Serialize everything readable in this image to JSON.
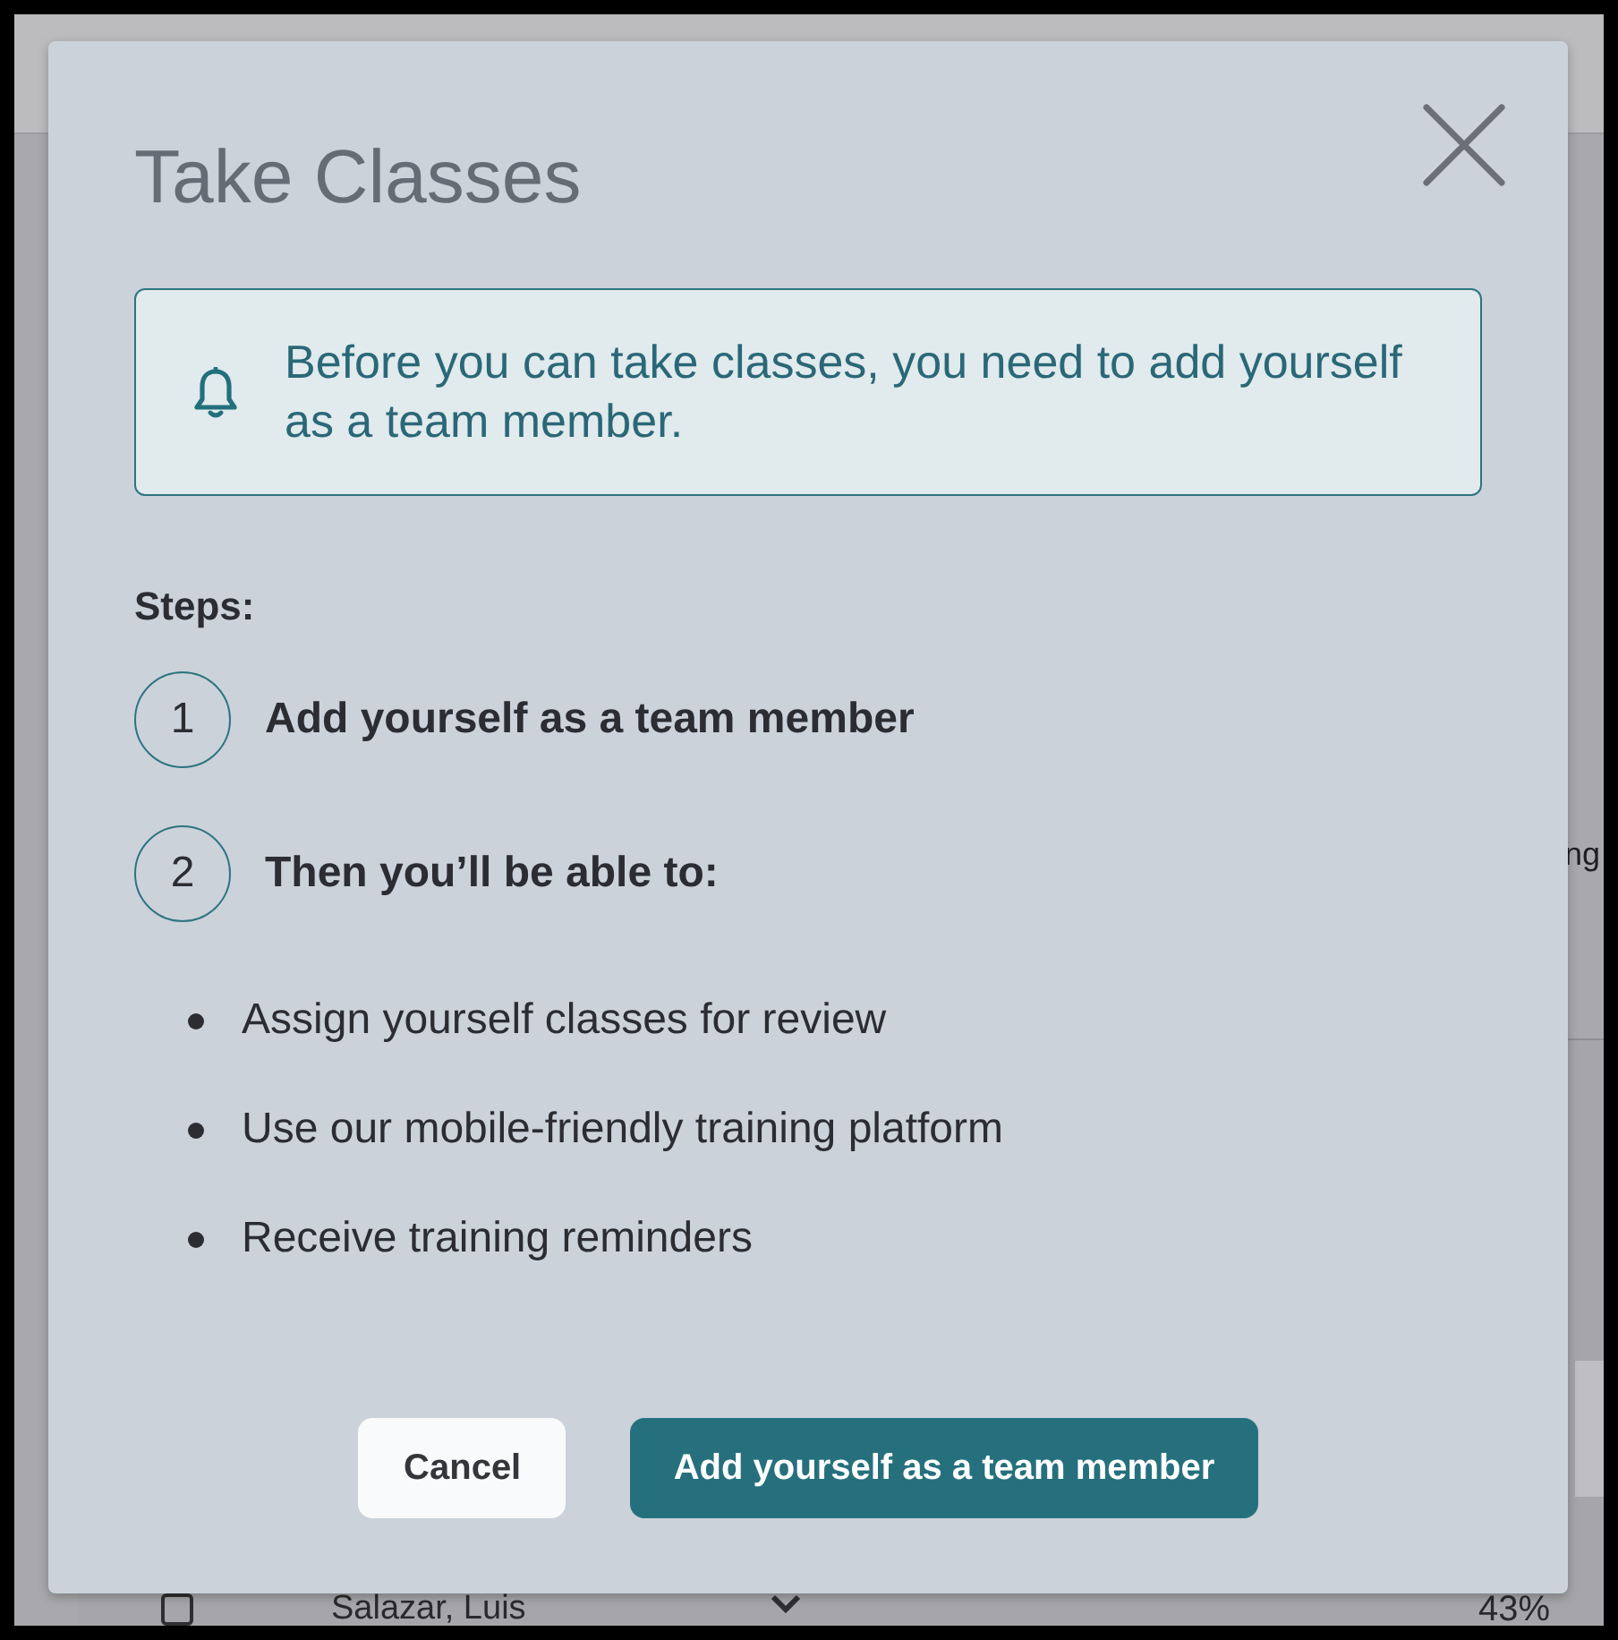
{
  "background_page": {
    "side_text": "ng",
    "row": {
      "checked": false,
      "name": "Salazar, Luis",
      "percent": "43%"
    }
  },
  "dialog": {
    "title": "Take Classes",
    "alert": {
      "text": "Before you can take classes, you need to add yourself as a team member."
    },
    "steps_heading": "Steps:",
    "steps": [
      {
        "number": "1",
        "label": "Add yourself as a team member"
      },
      {
        "number": "2",
        "label": "Then you’ll be able to:"
      }
    ],
    "benefits": [
      "Assign yourself classes for review",
      "Use our mobile-friendly training platform",
      "Receive training reminders"
    ],
    "buttons": [
      {
        "label": "Cancel",
        "kind": "secondary"
      },
      {
        "label": "Add yourself as a team member",
        "kind": "primary"
      }
    ]
  }
}
